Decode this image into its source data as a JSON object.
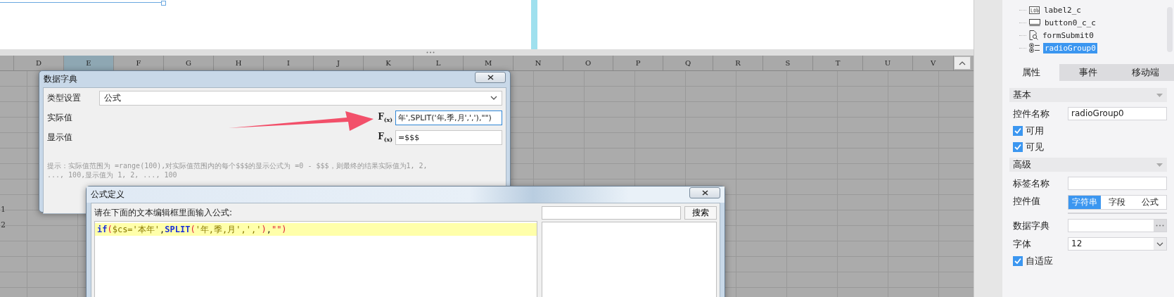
{
  "canvas": {
    "columns": [
      {
        "label": "D",
        "selected": false
      },
      {
        "label": "E",
        "selected": true
      },
      {
        "label": "F",
        "selected": false
      },
      {
        "label": "G",
        "selected": false
      },
      {
        "label": "H",
        "selected": false
      },
      {
        "label": "I",
        "selected": false
      },
      {
        "label": "J",
        "selected": false
      },
      {
        "label": "K",
        "selected": false
      },
      {
        "label": "L",
        "selected": false
      },
      {
        "label": "M",
        "selected": false
      },
      {
        "label": "N",
        "selected": false
      },
      {
        "label": "O",
        "selected": false
      },
      {
        "label": "P",
        "selected": false
      },
      {
        "label": "Q",
        "selected": false
      },
      {
        "label": "R",
        "selected": false
      },
      {
        "label": "S",
        "selected": false
      },
      {
        "label": "T",
        "selected": false
      },
      {
        "label": "U",
        "selected": false
      },
      {
        "label": "V",
        "selected": false
      }
    ],
    "row_numbers": [
      "1",
      "2"
    ]
  },
  "data_dialog": {
    "title": "数据字典",
    "type_label": "类型设置",
    "type_value": "公式",
    "rows": [
      {
        "label": "实际值",
        "fx": "F$_{(x)}$",
        "value": "年',SPLIT('年,季,月',','),\"\")",
        "focused": true
      },
      {
        "label": "显示值",
        "fx": "F$_{(x)}$",
        "value": "=$$$",
        "focused": false
      }
    ],
    "hint_lines": [
      "提示：实际值范围为 =range(100),对实际值范围内的每个$$$的显示公式为 =0 - $$$，则最终的结果实际值为1, 2,",
      "..., 100,显示值为 1, 2, ..., 100"
    ]
  },
  "formula_dialog": {
    "title": "公式定义",
    "prompt": "请在下面的文本编辑框里面输入公式:",
    "search_button": "搜索",
    "code_tokens": [
      {
        "kind": "keyword",
        "text": "if"
      },
      {
        "kind": "paren",
        "text": "("
      },
      {
        "kind": "string",
        "text": "$cs='本年'"
      },
      {
        "kind": "plain",
        "text": ","
      },
      {
        "kind": "keyword",
        "text": "SPLIT"
      },
      {
        "kind": "paren",
        "text": "("
      },
      {
        "kind": "string",
        "text": "'年,季,月',','"
      },
      {
        "kind": "paren",
        "text": ")"
      },
      {
        "kind": "plain",
        "text": ","
      },
      {
        "kind": "paren",
        "text": "\"\")"
      }
    ]
  },
  "tree": [
    {
      "label": "label2_c",
      "kind": "label",
      "selected": false
    },
    {
      "label": "button0_c_c",
      "kind": "button",
      "selected": false
    },
    {
      "label": "formSubmit0",
      "kind": "form",
      "selected": false
    },
    {
      "label": "radioGroup0",
      "kind": "radio",
      "selected": true
    }
  ],
  "tabs": [
    {
      "label": "属性",
      "selected": true
    },
    {
      "label": "事件",
      "selected": false
    },
    {
      "label": "移动端",
      "selected": false
    }
  ],
  "sections": [
    {
      "title": "基本",
      "rows": [
        {
          "kind": "text",
          "label": "控件名称",
          "value": "radioGroup0"
        },
        {
          "kind": "checkbox",
          "label": "可用",
          "checked": true
        },
        {
          "kind": "checkbox",
          "label": "可见",
          "checked": true
        }
      ]
    },
    {
      "title": "高级",
      "rows": [
        {
          "kind": "text",
          "label": "标签名称"
        },
        {
          "kind": "segmented",
          "label": "控件值",
          "options": [
            {
              "label": "字符串",
              "selected": true
            },
            {
              "label": "字段",
              "selected": false
            },
            {
              "label": "公式",
              "selected": false
            }
          ]
        },
        {
          "kind": "picker",
          "label": "数据字典"
        },
        {
          "kind": "select",
          "label": "字体",
          "value": "12"
        },
        {
          "kind": "checkbox",
          "label": "自适应",
          "checked": true
        }
      ]
    }
  ]
}
